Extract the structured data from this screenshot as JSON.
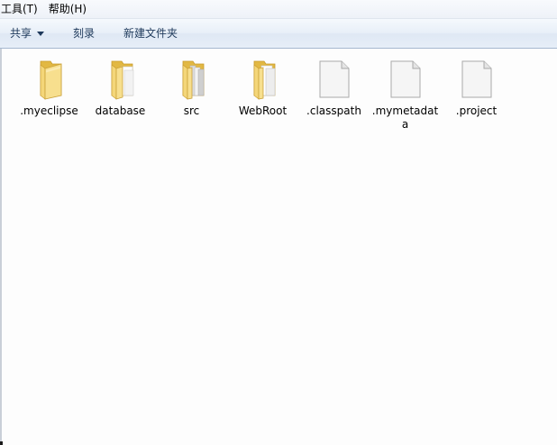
{
  "menubar": {
    "items": [
      {
        "label": "工具(T)"
      },
      {
        "label": "帮助(H)"
      }
    ]
  },
  "command_bar": {
    "share_label": "共享",
    "burn_label": "刻录",
    "new_folder_label": "新建文件夹"
  },
  "files": [
    {
      "name": ".myeclipse",
      "kind": "folder",
      "icon": "folder-icon"
    },
    {
      "name": "database",
      "kind": "folder",
      "icon": "folder-icon"
    },
    {
      "name": "src",
      "kind": "folder",
      "icon": "folder-icon"
    },
    {
      "name": "WebRoot",
      "kind": "folder",
      "icon": "folder-icon"
    },
    {
      "name": ".classpath",
      "kind": "file",
      "icon": "file-icon"
    },
    {
      "name": ".mymetadata",
      "kind": "file",
      "icon": "file-icon"
    },
    {
      "name": ".project",
      "kind": "file",
      "icon": "file-icon"
    }
  ],
  "colors": {
    "folder_back": "#e9c04e",
    "folder_front": "#f6dc85",
    "command_text": "#1e395b",
    "command_border": "#a5b7cf"
  }
}
